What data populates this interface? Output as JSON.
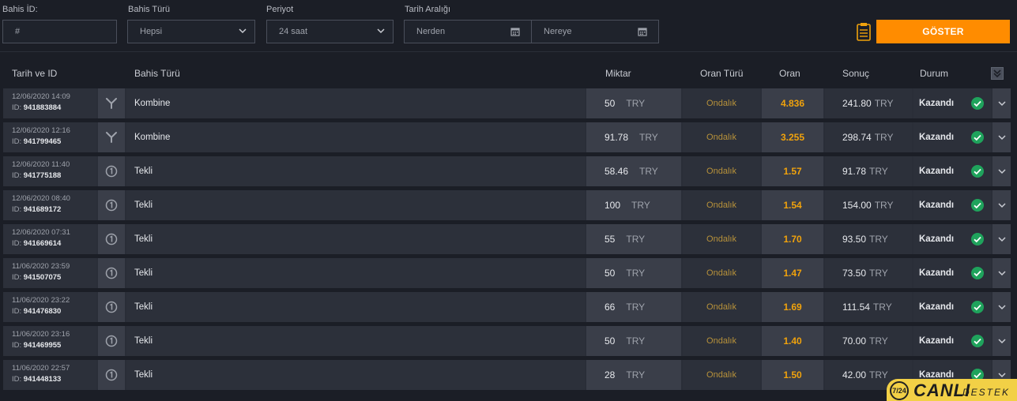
{
  "filters": {
    "bet_id_label": "Bahis İD:",
    "bet_id_placeholder": "#",
    "bet_type_label": "Bahis Türü",
    "bet_type_value": "Hepsi",
    "period_label": "Periyot",
    "period_value": "24 saat",
    "date_range_label": "Tarih Aralığı",
    "from_placeholder": "Nerden",
    "to_placeholder": "Nereye",
    "show_button": "GÖSTER"
  },
  "columns": {
    "date_id": "Tarih ve ID",
    "bet_type": "Bahis Türü",
    "amount": "Miktar",
    "odds_type": "Oran Türü",
    "odds": "Oran",
    "result": "Sonuç",
    "status": "Durum"
  },
  "rows": [
    {
      "date": "12/06/2020 14:09",
      "id_prefix": "ID:",
      "id": "941883884",
      "type_icon": "combo-icon",
      "type": "Kombine",
      "amount": "50",
      "currency": "TRY",
      "odds_type": "Ondalık",
      "odds": "4.836",
      "result": "241.80",
      "status": "Kazandı"
    },
    {
      "date": "12/06/2020 12:16",
      "id_prefix": "ID:",
      "id": "941799465",
      "type_icon": "combo-icon",
      "type": "Kombine",
      "amount": "91.78",
      "currency": "TRY",
      "odds_type": "Ondalık",
      "odds": "3.255",
      "result": "298.74",
      "status": "Kazandı"
    },
    {
      "date": "12/06/2020 11:40",
      "id_prefix": "ID:",
      "id": "941775188",
      "type_icon": "single-icon",
      "type": "Tekli",
      "amount": "58.46",
      "currency": "TRY",
      "odds_type": "Ondalık",
      "odds": "1.57",
      "result": "91.78",
      "status": "Kazandı"
    },
    {
      "date": "12/06/2020 08:40",
      "id_prefix": "ID:",
      "id": "941689172",
      "type_icon": "single-icon",
      "type": "Tekli",
      "amount": "100",
      "currency": "TRY",
      "odds_type": "Ondalık",
      "odds": "1.54",
      "result": "154.00",
      "status": "Kazandı"
    },
    {
      "date": "12/06/2020 07:31",
      "id_prefix": "ID:",
      "id": "941669614",
      "type_icon": "single-icon",
      "type": "Tekli",
      "amount": "55",
      "currency": "TRY",
      "odds_type": "Ondalık",
      "odds": "1.70",
      "result": "93.50",
      "status": "Kazandı"
    },
    {
      "date": "11/06/2020 23:59",
      "id_prefix": "ID:",
      "id": "941507075",
      "type_icon": "single-icon",
      "type": "Tekli",
      "amount": "50",
      "currency": "TRY",
      "odds_type": "Ondalık",
      "odds": "1.47",
      "result": "73.50",
      "status": "Kazandı"
    },
    {
      "date": "11/06/2020 23:22",
      "id_prefix": "ID:",
      "id": "941476830",
      "type_icon": "single-icon",
      "type": "Tekli",
      "amount": "66",
      "currency": "TRY",
      "odds_type": "Ondalık",
      "odds": "1.69",
      "result": "111.54",
      "status": "Kazandı"
    },
    {
      "date": "11/06/2020 23:16",
      "id_prefix": "ID:",
      "id": "941469955",
      "type_icon": "single-icon",
      "type": "Tekli",
      "amount": "50",
      "currency": "TRY",
      "odds_type": "Ondalık",
      "odds": "1.40",
      "result": "70.00",
      "status": "Kazandı"
    },
    {
      "date": "11/06/2020 22:57",
      "id_prefix": "ID:",
      "id": "941448133",
      "type_icon": "single-icon",
      "type": "Tekli",
      "amount": "28",
      "currency": "TRY",
      "odds_type": "Ondalık",
      "odds": "1.50",
      "result": "42.00",
      "status": "Kazandı"
    }
  ],
  "support_widget": {
    "badge": "7/24",
    "title": "CANLI",
    "subtitle": "DESTEK"
  },
  "colors": {
    "accent": "#ff8c00",
    "odds": "#f0a20c",
    "odds_type": "#b8923a",
    "win": "#1fa35c",
    "background": "#1b1e26"
  }
}
